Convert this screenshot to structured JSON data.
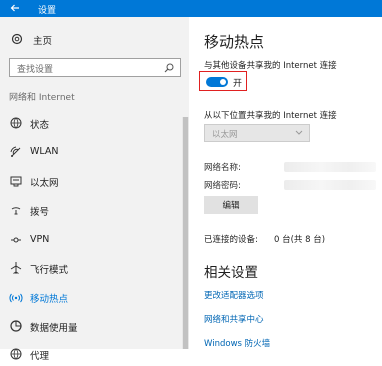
{
  "titlebar": {
    "back_icon": "arrow-left-icon",
    "title": "设置"
  },
  "sidebar": {
    "home_label": "主页",
    "search_placeholder": "查找设置",
    "section_label": "网络和 Internet",
    "items": [
      {
        "label": "状态",
        "icon": "globe-icon"
      },
      {
        "label": "WLAN",
        "icon": "wifi-icon"
      },
      {
        "label": "以太网",
        "icon": "ethernet-icon"
      },
      {
        "label": "拨号",
        "icon": "dial-up-icon"
      },
      {
        "label": "VPN",
        "icon": "vpn-icon"
      },
      {
        "label": "飞行模式",
        "icon": "airplane-icon"
      },
      {
        "label": "移动热点",
        "icon": "hotspot-icon",
        "active": true
      },
      {
        "label": "数据使用量",
        "icon": "data-usage-icon"
      },
      {
        "label": "代理",
        "icon": "globe-icon"
      }
    ]
  },
  "main": {
    "title": "移动热点",
    "share_label": "与其他设备共享我的 Internet 连接",
    "toggle_state": "开",
    "toggle_on": true,
    "from_label": "从以下位置共享我的 Internet 连接",
    "from_select_value": "以太网",
    "network_name_label": "网络名称:",
    "network_password_label": "网络密码:",
    "edit_button": "编辑",
    "connected_label": "已连接的设备:",
    "connected_value": "0 台(共 8 台)",
    "related_title": "相关设置",
    "related_links": [
      "更改适配器选项",
      "网络和共享中心",
      "Windows 防火墙"
    ]
  },
  "colors": {
    "accent": "#0078d7",
    "highlight_border": "#e02020",
    "link": "#0066b4"
  }
}
